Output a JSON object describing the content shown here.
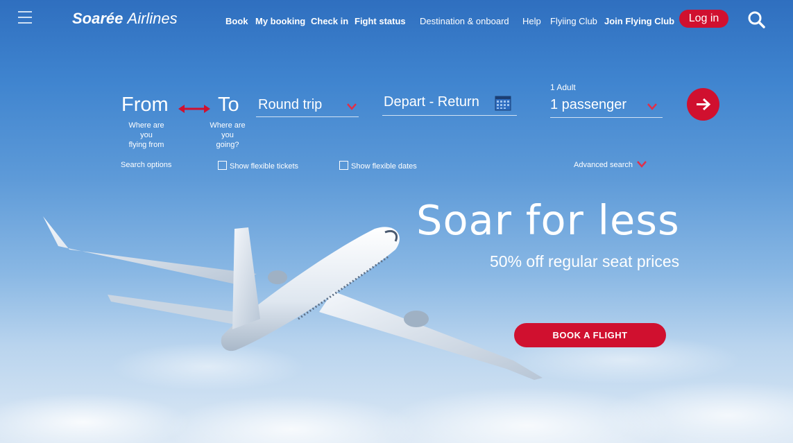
{
  "brand": {
    "name_bold": "Soarée",
    "name_rest": "Airlines"
  },
  "nav": {
    "book": "Book",
    "my_booking": "My booking",
    "check_in": "Check in",
    "flight_status": "Fight status",
    "destination": "Destination & onboard",
    "help": "Help",
    "flying_club": "Flyiing Club",
    "join_club": "Join Flying Club",
    "login": "Log in"
  },
  "search": {
    "from_label": "From",
    "from_hint_1": "Where are you",
    "from_hint_2": "flying from",
    "to_label": "To",
    "to_hint_1": "Where are you",
    "to_hint_2": "going?",
    "trip_type": "Round trip",
    "dates": "Depart - Return",
    "passenger_count_label": "1 Adult",
    "passengers": "1 passenger",
    "search_options": "Search options",
    "flexible_tickets": "Show flexible tickets",
    "flexible_dates": "Show flexible dates",
    "advanced": "Advanced search"
  },
  "hero": {
    "headline": "Soar for less",
    "subheadline": "50% off regular seat prices",
    "cta": "BOOK A FLIGHT"
  },
  "colors": {
    "accent": "#d0102f",
    "sky_top": "#2f6fbf",
    "sky_bottom": "#dde9f5"
  },
  "icons": [
    "menu-icon",
    "search-icon",
    "swap-arrows-icon",
    "chevron-down-icon",
    "calendar-icon",
    "arrow-right-icon",
    "checkbox-icon"
  ]
}
